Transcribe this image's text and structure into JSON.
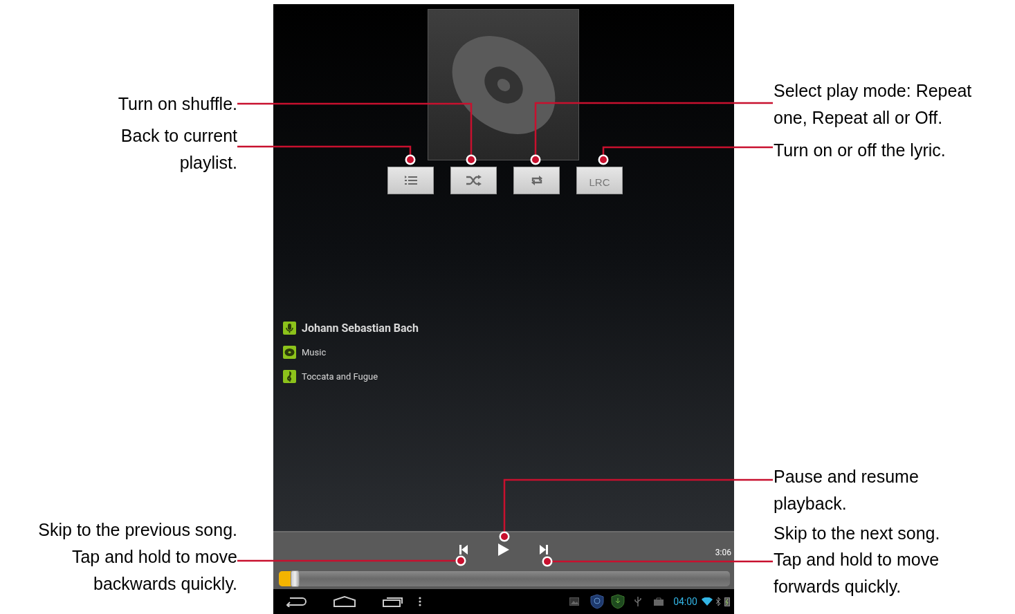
{
  "left_callouts": [
    {
      "text": "Turn on shuffle."
    },
    {
      "text": "Back to current playlist."
    },
    {
      "text": "Skip to the previous song."
    },
    {
      "text": "Tap and hold to move backwards quickly."
    }
  ],
  "right_callouts": [
    {
      "text": "Select play mode: Repeat one, Repeat all or Off."
    },
    {
      "text": "Turn on or off the lyric."
    },
    {
      "text": "Pause and resume playback."
    },
    {
      "text": "Skip to the next song."
    },
    {
      "text": "Tap and hold to move forwards quickly."
    }
  ],
  "player": {
    "mode_buttons": [
      {
        "kind": "playlist"
      },
      {
        "kind": "shuffle"
      },
      {
        "kind": "repeat"
      },
      {
        "kind": "text",
        "label": "LRC"
      }
    ],
    "track_info": [
      {
        "kind": "artist",
        "text": "Johann Sebastian Bach"
      },
      {
        "kind": "album",
        "text": "Music"
      },
      {
        "kind": "title",
        "text": "Toccata and Fugue"
      }
    ],
    "duration": "3:06",
    "progress": {
      "level": 0.03
    }
  },
  "status_bar": {
    "time": "04:00"
  }
}
